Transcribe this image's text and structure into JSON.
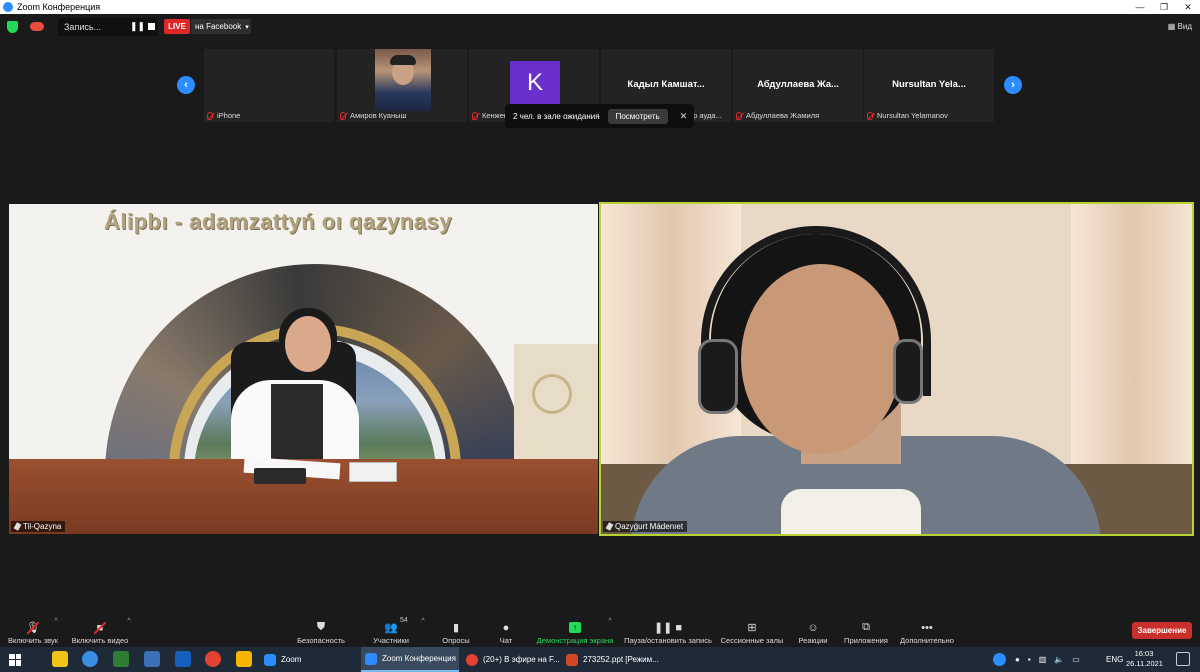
{
  "window": {
    "title": "Zoom Конференция",
    "minimize": "—",
    "maximize": "❐",
    "close": "✕"
  },
  "topbar": {
    "recording_label": "Запись...",
    "pause_icon": "❚❚",
    "live_badge": "LIVE",
    "stream_target": "на Facebook",
    "view_label": "Вид"
  },
  "gallery": {
    "prev": "‹",
    "next": "›",
    "participants": [
      {
        "label": "iPhone",
        "display": ""
      },
      {
        "label": "Амиров Куаныш",
        "display": ""
      },
      {
        "label": "Кенжеғ",
        "display": "",
        "avatar_letter": "K",
        "avatar_color": "#6a2fcc"
      },
      {
        "label": "ар ауда...",
        "display": "Кадыл  Камшат..."
      },
      {
        "label": "Абдуллаева Жамиля",
        "display": "Абдуллаева  Жа..."
      },
      {
        "label": "Nursultan Yelamanov",
        "display": "Nursultan  Yela..."
      }
    ]
  },
  "waiting_room": {
    "text": "2 чел. в зале ожидания",
    "button": "Посмотреть",
    "close": "✕"
  },
  "videos": {
    "left": {
      "name": "Til-Qazyna",
      "banner": "Álipbı - adamzattyń oı qazynasy"
    },
    "right": {
      "name": "Qazyǵurt Mádenıet",
      "active_speaker_color": "#b6d332"
    }
  },
  "toolbar": {
    "unmute": "Включить звук",
    "start_video": "Включить видео",
    "security": "Безопасность",
    "participants": "Участники",
    "participants_count": "54",
    "polls": "Опросы",
    "chat": "Чат",
    "share_screen": "Демонстрация экрана",
    "pause_recording": "Пауза/остановить запись",
    "breakout_rooms": "Сессионные залы",
    "reactions": "Реакции",
    "apps": "Приложения",
    "more": "Дополнительно",
    "end": "Завершение"
  },
  "taskbar": {
    "apps": [
      {
        "label": "Zoom",
        "color": "#2d8cff"
      },
      {
        "label": "Zoom Конференция",
        "color": "#2d8cff",
        "active": true
      },
      {
        "label": "(20+) В эфире на F...",
        "color": "#e34133"
      },
      {
        "label": "273252.ppt [Режим...",
        "color": "#d24726"
      }
    ],
    "language": "ENG",
    "time": "16:03",
    "date": "26.11.2021"
  }
}
